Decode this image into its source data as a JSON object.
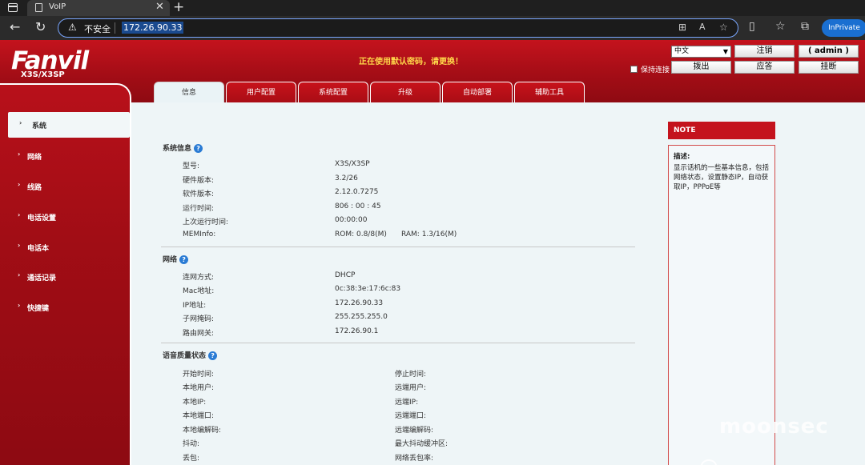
{
  "browser": {
    "tab_title": "VoIP",
    "tab_close": "✕",
    "new_tab": "+",
    "back": "←",
    "reload": "↻",
    "insecure_label": "不安全",
    "url": "172.26.90.33",
    "inprivate_label": "InPrivate"
  },
  "header": {
    "logo": "Fanvil",
    "model": "X3S/X3SP",
    "warning": "正在使用默认密码，请更换！",
    "language": "中文",
    "logout": "注销",
    "user": "( admin )",
    "keep_label": "保持连接",
    "dial": "拨出",
    "answer": "应答",
    "hangup": "挂断"
  },
  "tabs": [
    "信息",
    "用户配置",
    "系统配置",
    "升级",
    "自动部署",
    "辅助工具"
  ],
  "sidebar": {
    "items": [
      {
        "label": "系统",
        "active": true
      },
      {
        "label": "网络"
      },
      {
        "label": "线路"
      },
      {
        "label": "电话设置"
      },
      {
        "label": "电话本"
      },
      {
        "label": "通话记录"
      },
      {
        "label": "快捷键"
      }
    ]
  },
  "system_info": {
    "title": "系统信息",
    "rows": [
      {
        "label": "型号:",
        "value": "X3S/X3SP"
      },
      {
        "label": "硬件版本:",
        "value": "3.2/26"
      },
      {
        "label": "软件版本:",
        "value": "2.12.0.7275"
      },
      {
        "label": "运行时间:",
        "value": "806 : 00 : 45"
      },
      {
        "label": "上次运行时间:",
        "value": "00:00:00"
      },
      {
        "label": "MEMInfo:",
        "value": "ROM: 0.8/8(M)",
        "value2": "RAM: 1.3/16(M)"
      }
    ]
  },
  "network": {
    "title": "网络",
    "rows": [
      {
        "label": "连网方式:",
        "value": "DHCP"
      },
      {
        "label": "Mac地址:",
        "value": "0c:38:3e:17:6c:83"
      },
      {
        "label": "IP地址:",
        "value": "172.26.90.33"
      },
      {
        "label": "子网掩码:",
        "value": "255.255.255.0"
      },
      {
        "label": "路由网关:",
        "value": "172.26.90.1"
      }
    ]
  },
  "voice_quality": {
    "title": "语音质量状态",
    "rows": [
      {
        "left": "开始时间:",
        "right": "停止时间:"
      },
      {
        "left": "本地用户:",
        "right": "远端用户:"
      },
      {
        "left": "本地IP:",
        "right": "远端IP:"
      },
      {
        "left": "本地端口:",
        "right": "远端端口:"
      },
      {
        "left": "本地编解码:",
        "right": "远端编解码:"
      },
      {
        "left": "抖动:",
        "right": "最大抖动缓冲区:"
      },
      {
        "left": "丢包:",
        "right": "网络丢包率:"
      }
    ]
  },
  "note": {
    "header": "NOTE",
    "title": "描述:",
    "text": "显示话机的一些基本信息，包括网络状态，设置静态IP，自动获取IP，PPPoE等"
  },
  "watermark": "moonsec",
  "colors": {
    "brand_red": "#c4131d",
    "warning_yellow": "#ffd84a",
    "help_blue": "#2a7bd4"
  }
}
